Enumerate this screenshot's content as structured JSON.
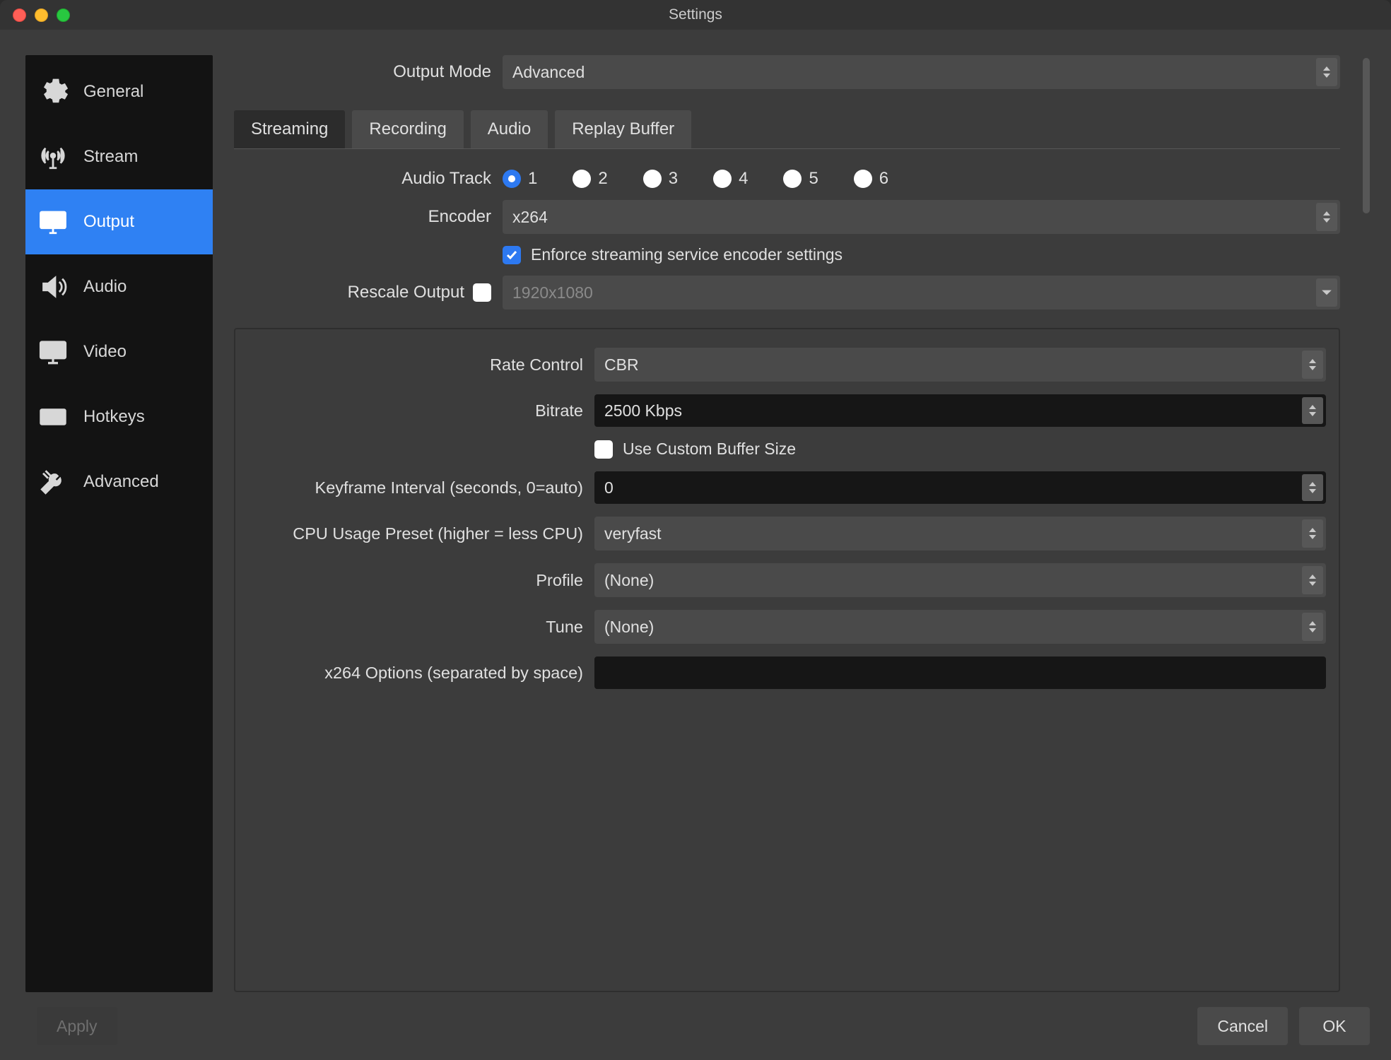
{
  "window": {
    "title": "Settings"
  },
  "sidebar": {
    "items": [
      {
        "label": "General"
      },
      {
        "label": "Stream"
      },
      {
        "label": "Output"
      },
      {
        "label": "Audio"
      },
      {
        "label": "Video"
      },
      {
        "label": "Hotkeys"
      },
      {
        "label": "Advanced"
      }
    ],
    "active_index": 2
  },
  "output_mode": {
    "label": "Output Mode",
    "value": "Advanced"
  },
  "tabs": [
    {
      "label": "Streaming"
    },
    {
      "label": "Recording"
    },
    {
      "label": "Audio"
    },
    {
      "label": "Replay Buffer"
    }
  ],
  "tabs_active_index": 0,
  "audio_track": {
    "label": "Audio Track",
    "options": [
      "1",
      "2",
      "3",
      "4",
      "5",
      "6"
    ],
    "selected_index": 0
  },
  "encoder": {
    "label": "Encoder",
    "value": "x264"
  },
  "enforce": {
    "checked": true,
    "label": "Enforce streaming service encoder settings"
  },
  "rescale": {
    "label": "Rescale Output",
    "checked": false,
    "placeholder": "1920x1080"
  },
  "panel": {
    "rate_control": {
      "label": "Rate Control",
      "value": "CBR"
    },
    "bitrate": {
      "label": "Bitrate",
      "value": "2500 Kbps"
    },
    "custom_buffer": {
      "checked": false,
      "label": "Use Custom Buffer Size"
    },
    "keyframe_interval": {
      "label": "Keyframe Interval (seconds, 0=auto)",
      "value": "0"
    },
    "cpu_preset": {
      "label": "CPU Usage Preset (higher = less CPU)",
      "value": "veryfast"
    },
    "profile": {
      "label": "Profile",
      "value": "(None)"
    },
    "tune": {
      "label": "Tune",
      "value": "(None)"
    },
    "x264_options": {
      "label": "x264 Options (separated by space)",
      "value": ""
    }
  },
  "footer": {
    "apply": "Apply",
    "cancel": "Cancel",
    "ok": "OK"
  }
}
